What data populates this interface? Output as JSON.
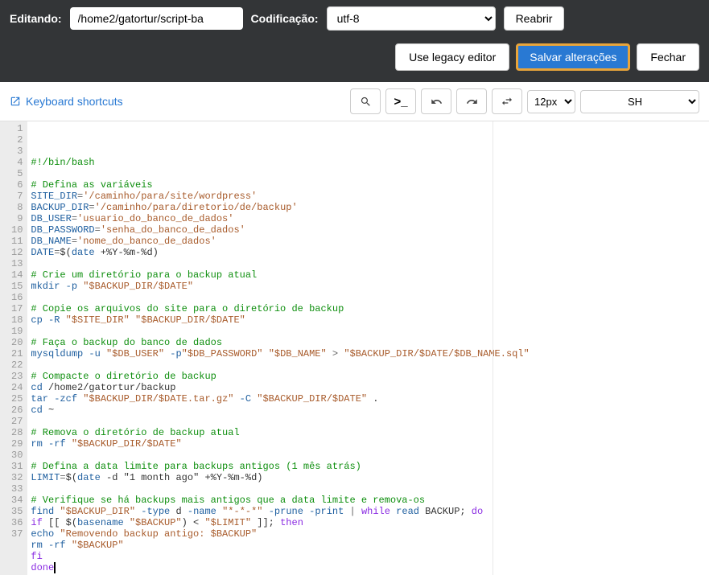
{
  "topbar": {
    "editing_label": "Editando:",
    "path_value": "/home2/gatortur/script-ba",
    "encoding_label": "Codificação:",
    "encoding_value": "utf-8",
    "reopen_label": "Reabrir"
  },
  "actionbar": {
    "legacy_label": "Use legacy editor",
    "save_label": "Salvar alterações",
    "close_label": "Fechar"
  },
  "toolbar": {
    "keyboard_shortcuts": "Keyboard shortcuts",
    "font_size": "12px",
    "language": "SH"
  },
  "code": {
    "lines": [
      {
        "n": 1,
        "t": "shebang",
        "text": "#!/bin/bash"
      },
      {
        "n": 2,
        "t": "blank",
        "text": ""
      },
      {
        "n": 3,
        "t": "comment",
        "text": "# Defina as variáveis"
      },
      {
        "n": 4,
        "t": "assign",
        "var": "SITE_DIR",
        "val": "'/caminho/para/site/wordpress'"
      },
      {
        "n": 5,
        "t": "assign",
        "var": "BACKUP_DIR",
        "val": "'/caminho/para/diretorio/de/backup'"
      },
      {
        "n": 6,
        "t": "assign",
        "var": "DB_USER",
        "val": "'usuario_do_banco_de_dados'"
      },
      {
        "n": 7,
        "t": "assign",
        "var": "DB_PASSWORD",
        "val": "'senha_do_banco_de_dados'"
      },
      {
        "n": 8,
        "t": "assign",
        "var": "DB_NAME",
        "val": "'nome_do_banco_de_dados'"
      },
      {
        "n": 9,
        "t": "assign_expr",
        "var": "DATE",
        "pre": "$(",
        "cmd": "date",
        "args": " +%Y-%m-%d",
        "post": ")"
      },
      {
        "n": 10,
        "t": "blank",
        "text": ""
      },
      {
        "n": 11,
        "t": "comment",
        "text": "# Crie um diretório para o backup atual"
      },
      {
        "n": 12,
        "t": "cmd",
        "cmd": "mkdir",
        "parts": [
          {
            "c": "opt",
            "v": " -p "
          },
          {
            "c": "str",
            "v": "\"$BACKUP_DIR/$DATE\""
          }
        ]
      },
      {
        "n": 13,
        "t": "blank",
        "text": ""
      },
      {
        "n": 14,
        "t": "comment",
        "text": "# Copie os arquivos do site para o diretório de backup"
      },
      {
        "n": 15,
        "t": "cmd",
        "cmd": "cp",
        "parts": [
          {
            "c": "opt",
            "v": " -R "
          },
          {
            "c": "str",
            "v": "\"$SITE_DIR\""
          },
          {
            "c": "plain",
            "v": " "
          },
          {
            "c": "str",
            "v": "\"$BACKUP_DIR/$DATE\""
          }
        ]
      },
      {
        "n": 16,
        "t": "blank",
        "text": ""
      },
      {
        "n": 17,
        "t": "comment",
        "text": "# Faça o backup do banco de dados"
      },
      {
        "n": 18,
        "t": "cmd",
        "cmd": "mysqldump",
        "parts": [
          {
            "c": "opt",
            "v": " -u "
          },
          {
            "c": "str",
            "v": "\"$DB_USER\""
          },
          {
            "c": "opt",
            "v": " -p"
          },
          {
            "c": "str",
            "v": "\"$DB_PASSWORD\""
          },
          {
            "c": "plain",
            "v": " "
          },
          {
            "c": "str",
            "v": "\"$DB_NAME\""
          },
          {
            "c": "redir",
            "v": " > "
          },
          {
            "c": "str",
            "v": "\"$BACKUP_DIR/$DATE/$DB_NAME.sql\""
          }
        ]
      },
      {
        "n": 19,
        "t": "blank",
        "text": ""
      },
      {
        "n": 20,
        "t": "comment",
        "text": "# Compacte o diretório de backup"
      },
      {
        "n": 21,
        "t": "cmd",
        "cmd": "cd",
        "parts": [
          {
            "c": "plain",
            "v": " /home2/gatortur/backup"
          }
        ]
      },
      {
        "n": 22,
        "t": "cmd",
        "cmd": "tar",
        "parts": [
          {
            "c": "opt",
            "v": " -zcf "
          },
          {
            "c": "str",
            "v": "\"$BACKUP_DIR/$DATE.tar.gz\""
          },
          {
            "c": "opt",
            "v": " -C "
          },
          {
            "c": "str",
            "v": "\"$BACKUP_DIR/$DATE\""
          },
          {
            "c": "plain",
            "v": " ."
          }
        ]
      },
      {
        "n": 23,
        "t": "cmd",
        "cmd": "cd",
        "parts": [
          {
            "c": "plain",
            "v": " ~"
          }
        ]
      },
      {
        "n": 24,
        "t": "blank",
        "text": ""
      },
      {
        "n": 25,
        "t": "comment",
        "text": "# Remova o diretório de backup atual"
      },
      {
        "n": 26,
        "t": "cmd",
        "cmd": "rm",
        "parts": [
          {
            "c": "opt",
            "v": " -rf "
          },
          {
            "c": "str",
            "v": "\"$BACKUP_DIR/$DATE\""
          }
        ]
      },
      {
        "n": 27,
        "t": "blank",
        "text": ""
      },
      {
        "n": 28,
        "t": "comment",
        "text": "# Defina a data limite para backups antigos (1 mês atrás)"
      },
      {
        "n": 29,
        "t": "assign_expr",
        "var": "LIMIT",
        "pre": "$(",
        "cmd": "date",
        "args": " -d \"1 month ago\" +%Y-%m-%d",
        "post": ")"
      },
      {
        "n": 30,
        "t": "blank",
        "text": ""
      },
      {
        "n": 31,
        "t": "comment",
        "text": "# Verifique se há backups mais antigos que a data limite e remova-os"
      },
      {
        "n": 32,
        "t": "cmd",
        "cmd": "find",
        "parts": [
          {
            "c": "plain",
            "v": " "
          },
          {
            "c": "str",
            "v": "\"$BACKUP_DIR\""
          },
          {
            "c": "opt",
            "v": " -type"
          },
          {
            "c": "plain",
            "v": " d "
          },
          {
            "c": "opt",
            "v": "-name "
          },
          {
            "c": "str",
            "v": "\"*-*-*\""
          },
          {
            "c": "opt",
            "v": " -prune -print"
          },
          {
            "c": "pipe",
            "v": " | "
          },
          {
            "c": "kw",
            "v": "while"
          },
          {
            "c": "cmd",
            "v": " read"
          },
          {
            "c": "plain",
            "v": " BACKUP; "
          },
          {
            "c": "kw",
            "v": "do"
          }
        ]
      },
      {
        "n": 33,
        "t": "raw",
        "parts": [
          {
            "c": "kw",
            "v": "if"
          },
          {
            "c": "plain",
            "v": " [[ $("
          },
          {
            "c": "cmd",
            "v": "basename"
          },
          {
            "c": "plain",
            "v": " "
          },
          {
            "c": "str",
            "v": "\"$BACKUP\""
          },
          {
            "c": "plain",
            "v": ") < "
          },
          {
            "c": "str",
            "v": "\"$LIMIT\""
          },
          {
            "c": "plain",
            "v": " ]]; "
          },
          {
            "c": "kw",
            "v": "then"
          }
        ]
      },
      {
        "n": 34,
        "t": "cmd",
        "cmd": "echo",
        "parts": [
          {
            "c": "plain",
            "v": " "
          },
          {
            "c": "str",
            "v": "\"Removendo backup antigo: $BACKUP\""
          }
        ]
      },
      {
        "n": 35,
        "t": "cmd",
        "cmd": "rm",
        "parts": [
          {
            "c": "opt",
            "v": " -rf "
          },
          {
            "c": "str",
            "v": "\"$BACKUP\""
          }
        ]
      },
      {
        "n": 36,
        "t": "kw",
        "text": "fi"
      },
      {
        "n": 37,
        "t": "kw_cursor",
        "text": "done"
      }
    ]
  }
}
